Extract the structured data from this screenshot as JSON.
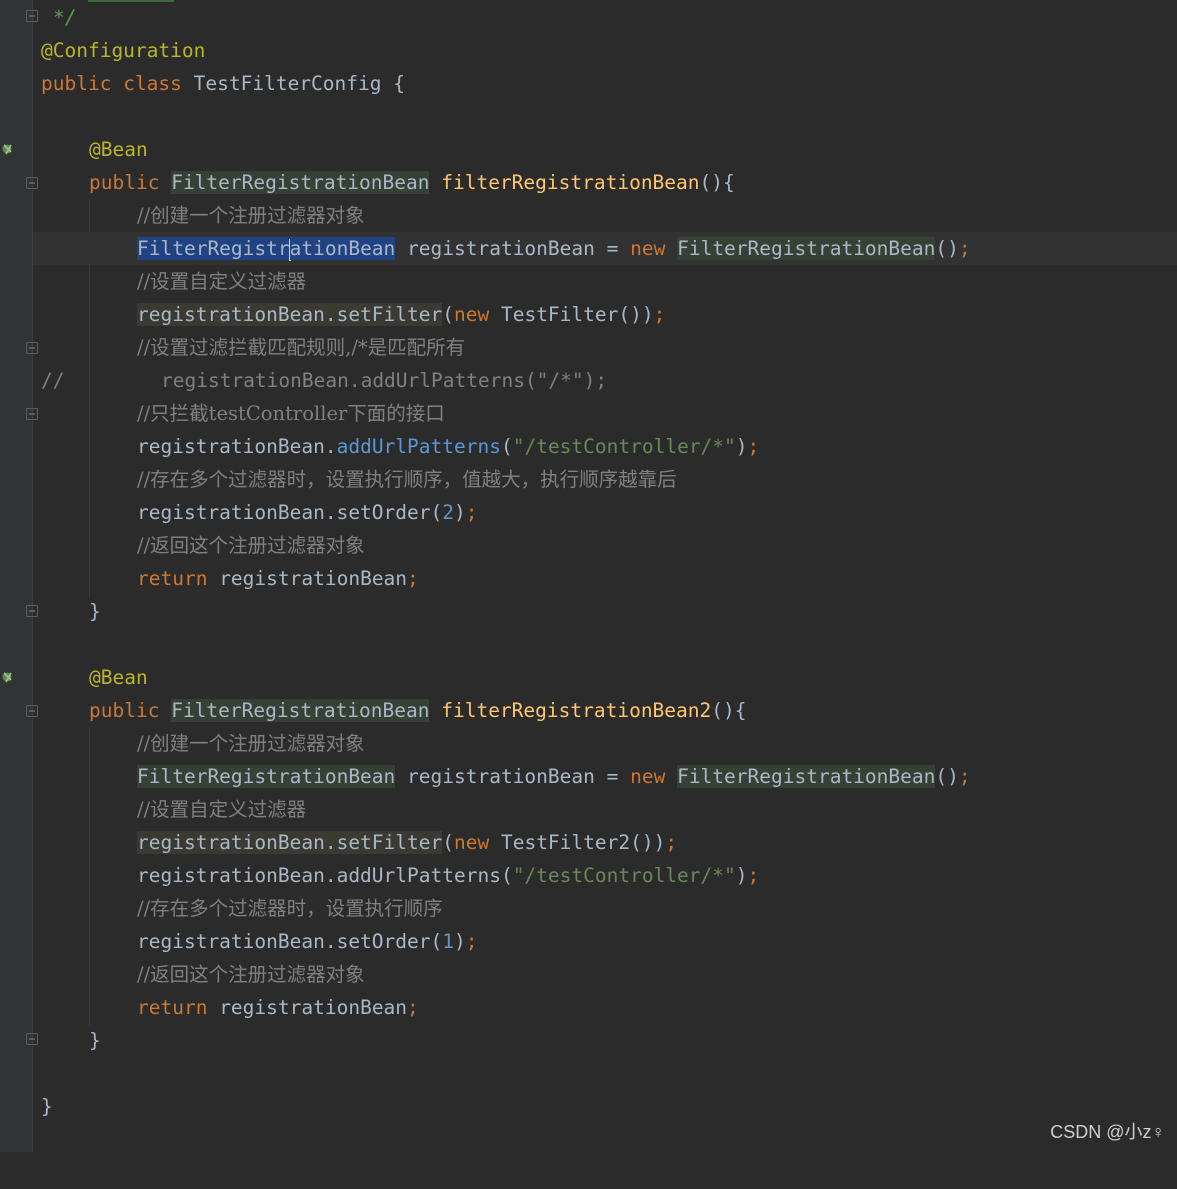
{
  "editor": {
    "lines": {
      "l0": "*/",
      "l1_ann": "@Configuration",
      "l2_kw1": "public",
      "l2_kw2": "class",
      "l2_name": "TestFilterConfig {",
      "l4_ann": "@Bean",
      "l5_kw": "public",
      "l5_type": "FilterRegistrationBean",
      "l5_fn": "filterRegistrationBean",
      "l5_tail": "(){",
      "l6_cm": "//创建一个注册过滤器对象",
      "l7_sel_a": "FilterRegistr",
      "l7_sel_b": "ationBean",
      "l7_var": " registrationBean = ",
      "l7_new": "new",
      "l7_type": "FilterRegistrationBean",
      "l7_tail": "()",
      "semi": ";",
      "l8_cm": "//设置自定义过滤器",
      "l9_warn": "registrationBean.setFilter",
      "l9_open": "(",
      "l9_new": "new",
      "l9_rest": " TestFilter())",
      "l10_cm": "//设置过滤拦截匹配规则,/*是匹配所有",
      "l11_slash": "//",
      "l11_code": "registrationBean.addUrlPatterns(\"/*\");",
      "l12_cm": "//只拦截testController下面的接口",
      "l13_obj": "registrationBean.",
      "l13_fn": "addUrlPatterns",
      "l13_open": "(",
      "l13_str": "\"/testController/*\"",
      "l13_close": ")",
      "l14_cm": "//存在多个过滤器时，设置执行顺序，值越大，执行顺序越靠后",
      "l15_obj": "registrationBean.setOrder(",
      "l15_num": "2",
      "l15_close": ")",
      "l16_cm": "//返回这个注册过滤器对象",
      "l17_kw": "return",
      "l17_var": " registrationBean",
      "l18": "}",
      "l20_ann": "@Bean",
      "l21_kw": "public",
      "l21_type": "FilterRegistrationBean",
      "l21_fn": "filterRegistrationBean2",
      "l21_tail": "(){",
      "l22_cm": "//创建一个注册过滤器对象",
      "l23_type": "FilterRegistrationBean",
      "l23_var": " registrationBean = ",
      "l23_new": "new",
      "l23_type2": "FilterRegistrationBean",
      "l23_tail": "()",
      "l24_cm": "//设置自定义过滤器",
      "l25_warn": "registrationBean.setFilter",
      "l25_open": "(",
      "l25_new": "new",
      "l25_rest": " TestFilter2())",
      "l26_obj": "registrationBean.addUrlPatterns(",
      "l26_str": "\"/testController/*\"",
      "l26_close": ")",
      "l27_cm": "//存在多个过滤器时，设置执行顺序",
      "l28_obj": "registrationBean.setOrder(",
      "l28_num": "1",
      "l28_close": ")",
      "l29_cm": "//返回这个注册过滤器对象",
      "l30_kw": "return",
      "l30_var": " registrationBean",
      "l31": "}",
      "l33": "}"
    }
  },
  "watermark": "CSDN @小z♀",
  "colors": {
    "background": "#2b2b2b",
    "keyword": "#cc7832",
    "annotation": "#bbb529",
    "method": "#ffc66d",
    "string": "#6a8759",
    "number": "#6897bb",
    "comment": "#808080",
    "selection": "#214283"
  },
  "icons": [
    "fold-marker-icon",
    "bean-run-icon",
    "intention-bulb-icon"
  ]
}
